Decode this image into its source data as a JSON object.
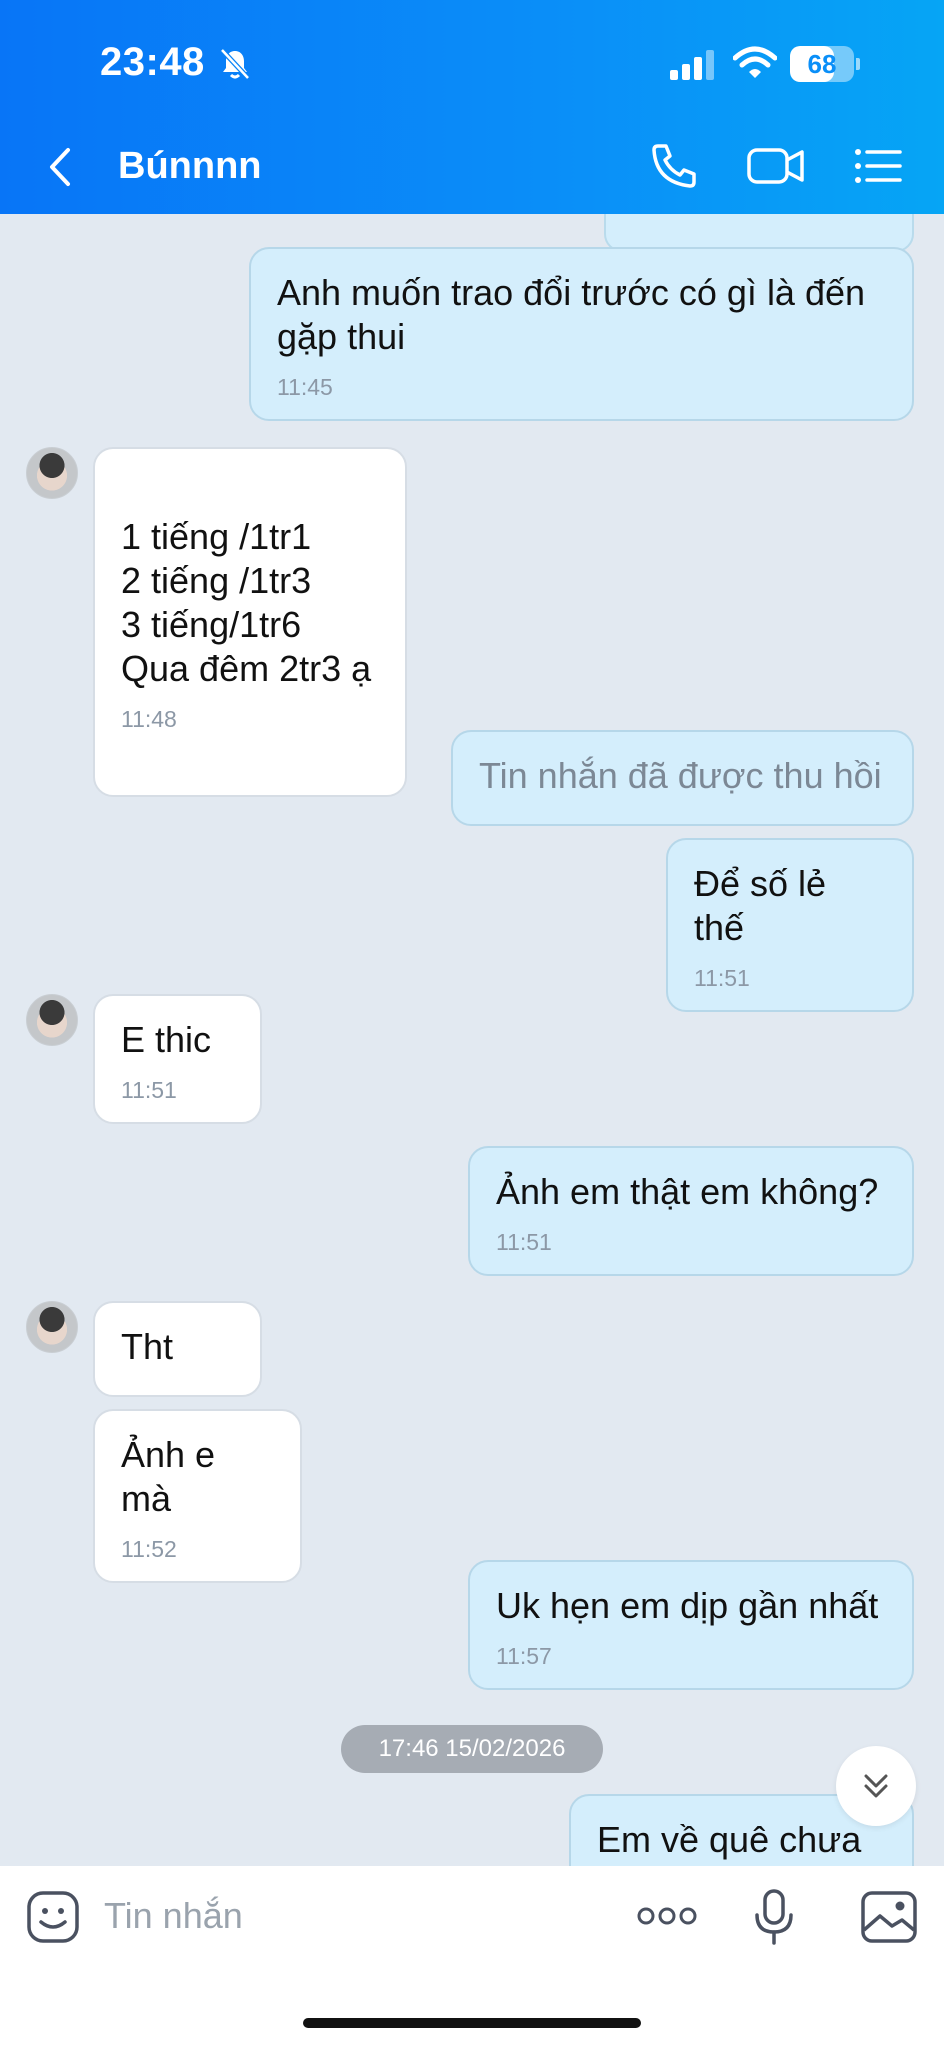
{
  "status_bar": {
    "time": "23:48",
    "battery": "68",
    "battery_level": 0.68
  },
  "header": {
    "title": "Búnnnn"
  },
  "messages": [
    {
      "from": "me",
      "text": "Anh muốn trao đổi trước có gì là đến gặp thui",
      "time": "11:45"
    },
    {
      "from": "them",
      "text": "1 tiếng /1tr1\n2 tiếng /1tr3\n3 tiếng/1tr6\nQua đêm 2tr3 ạ",
      "time": "11:48"
    },
    {
      "from": "me",
      "text": "Tin nhắn đã được thu hồi",
      "recalled": true
    },
    {
      "from": "me",
      "text": "Để số lẻ thế",
      "time": "11:51"
    },
    {
      "from": "them",
      "text": "E thic",
      "time": "11:51"
    },
    {
      "from": "me",
      "text": "Ảnh em thật em không?",
      "time": "11:51"
    },
    {
      "from": "them",
      "text": "Tht"
    },
    {
      "from": "them",
      "text": "Ảnh e mà",
      "time": "11:52"
    },
    {
      "from": "me",
      "text": "Uk hẹn em dịp gần nhất",
      "time": "11:57"
    },
    {
      "from": "me",
      "text": "Em về quê chưa á"
    }
  ],
  "date_separator": "17:46 15/02/2026",
  "input": {
    "placeholder": "Tin nhắn"
  }
}
